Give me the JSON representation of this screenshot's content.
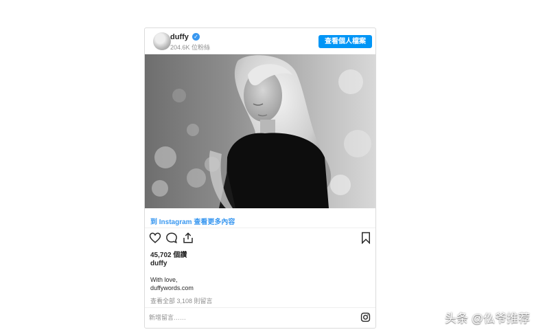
{
  "post": {
    "username": "duffy",
    "followers": "204.6K 位粉絲",
    "view_profile_label": "查看個人檔案",
    "instagram_link": "到 Instagram 查看更多內容",
    "likes": "45,702 個讚",
    "caption_user": "duffy",
    "caption_line1": "With love,",
    "caption_line2": "duffywords.com",
    "view_all_comments": "查看全部 3,108 則留言",
    "add_comment_placeholder": "新增留言……"
  },
  "icons": {
    "verified": "verified-badge-icon",
    "like": "heart-icon",
    "comment": "comment-icon",
    "share": "share-icon",
    "save": "bookmark-icon",
    "instagram": "instagram-logo-icon"
  },
  "colors": {
    "accent": "#0095f6",
    "link": "#3897f0",
    "border": "#dbdbdb",
    "muted": "#8e8e8e"
  },
  "watermark": "头条 @仫爷推荐"
}
